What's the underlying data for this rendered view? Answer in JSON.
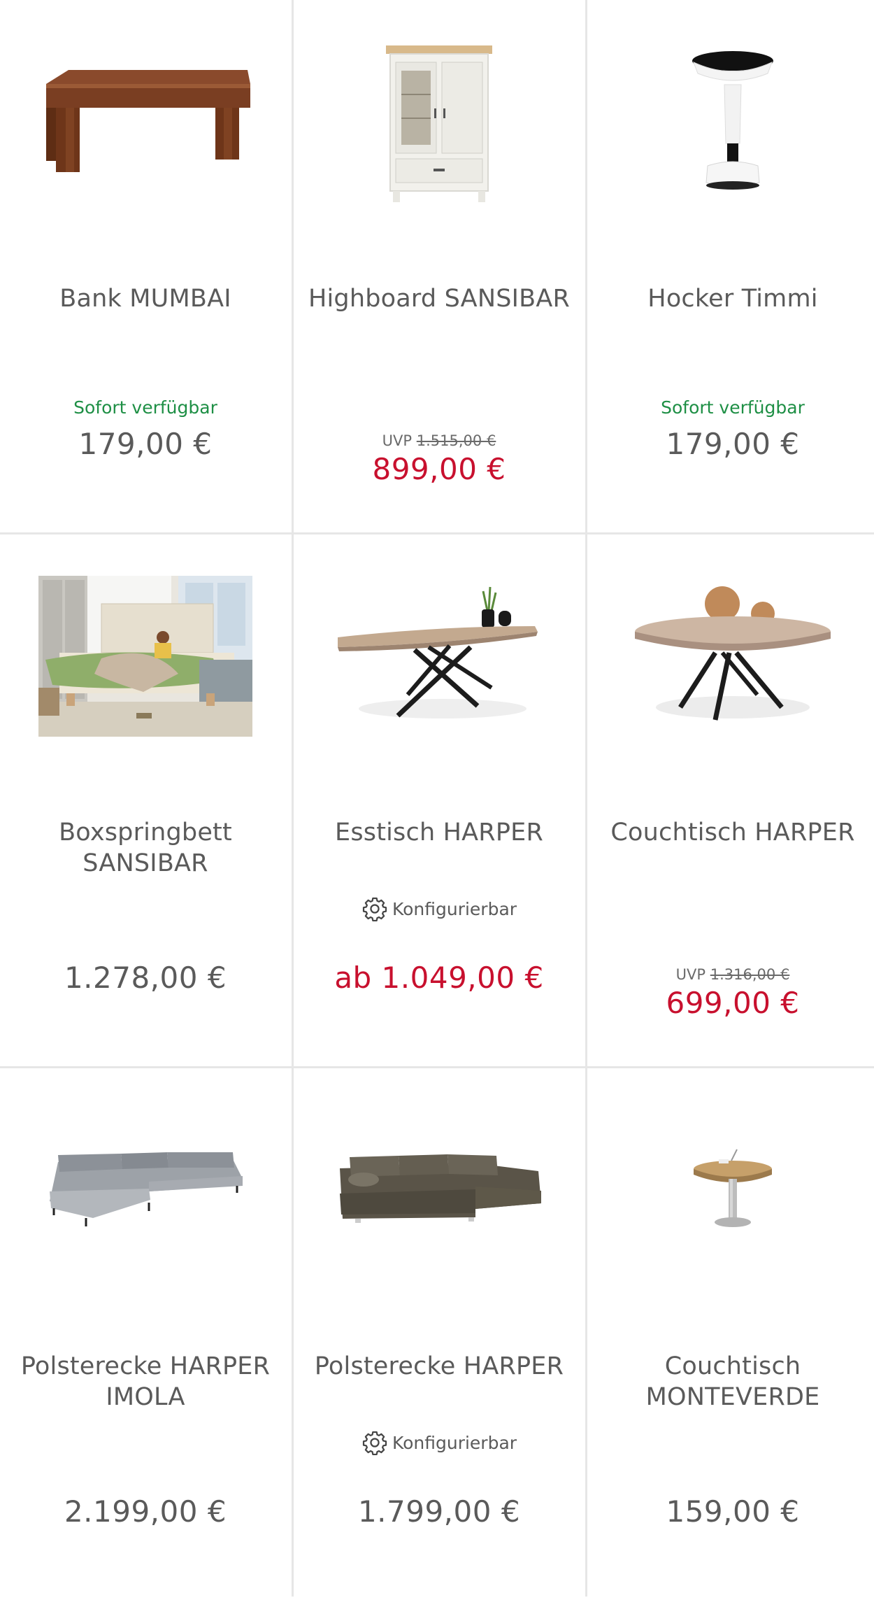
{
  "colors": {
    "divider": "#e6e6e6",
    "text": "#5a5a5a",
    "available_green": "#1e8f45",
    "sale_red": "#c8102e"
  },
  "products": [
    {
      "name": "Bank MUMBAI",
      "availability": "Sofort verfügbar",
      "price": "179,00 €",
      "image_icon": "wooden-bench-image"
    },
    {
      "name": "Highboard SANSIBAR",
      "uvp_label": "UVP",
      "uvp_price": "1.515,00 €",
      "price": "899,00 €",
      "image_icon": "white-highboard-image"
    },
    {
      "name": "Hocker Timmi",
      "availability": "Sofort verfügbar",
      "price": "179,00 €",
      "image_icon": "stool-image"
    },
    {
      "name": "Boxspringbett SANSIBAR",
      "price": "1.278,00 €",
      "image_icon": "boxspring-bed-photo"
    },
    {
      "name": "Esstisch HARPER",
      "config_label": "Konfigurierbar",
      "price": "ab 1.049,00 €",
      "image_icon": "dining-table-image"
    },
    {
      "name": "Couchtisch HARPER",
      "uvp_label": "UVP",
      "uvp_price": "1.316,00 €",
      "price": "699,00 €",
      "image_icon": "round-coffee-table-image"
    },
    {
      "name": "Polsterecke HARPER IMOLA",
      "price": "2.199,00 €",
      "image_icon": "grey-corner-sofa-image"
    },
    {
      "name": "Polsterecke HARPER",
      "config_label": "Konfigurierbar",
      "price": "1.799,00 €",
      "image_icon": "brown-corner-sofa-image"
    },
    {
      "name": "Couchtisch MONTEVERDE",
      "price": "159,00 €",
      "image_icon": "side-table-image"
    }
  ]
}
